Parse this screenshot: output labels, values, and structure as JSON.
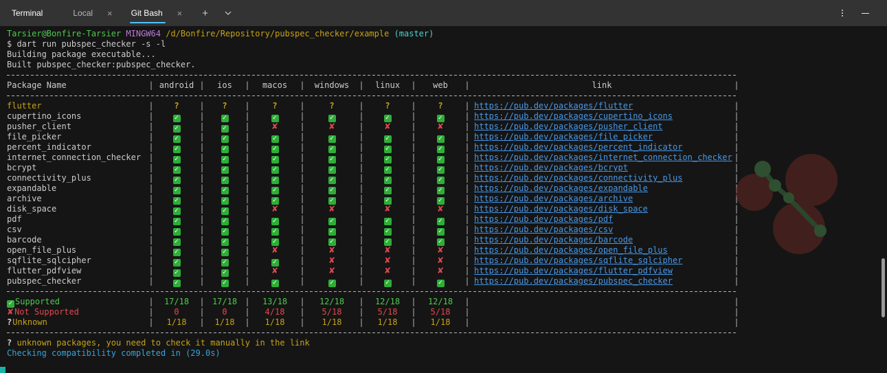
{
  "window": {
    "title": "Terminal",
    "tabs": [
      {
        "label": "Local"
      },
      {
        "label": "Git Bash",
        "active": true
      }
    ],
    "icons": {
      "new_tab": "+",
      "tab_close": "×",
      "dropdown": "chevron-down",
      "menu": "kebab",
      "minimize": "dash"
    }
  },
  "terminal": {
    "prompt": {
      "user_host": "Tarsier@Bonfire-Tarsier",
      "env": "MINGW64",
      "path": "/d/Bonfire/Repository/pubspec_checker/example",
      "branch": "(master)"
    },
    "command": "$ dart run pubspec_checker -s -l",
    "output": [
      "Building package executable...",
      "Built pubspec_checker:pubspec_checker."
    ],
    "table": {
      "headers": [
        "Package Name",
        "android",
        "ios",
        "macos",
        "windows",
        "linux",
        "web",
        "link"
      ],
      "packages": [
        {
          "name": "flutter",
          "highlight": true,
          "marks": [
            "q",
            "q",
            "q",
            "q",
            "q",
            "q"
          ],
          "link": "https://pub.dev/packages/flutter"
        },
        {
          "name": "cupertino_icons",
          "marks": [
            "check",
            "check",
            "check",
            "check",
            "check",
            "check"
          ],
          "link": "https://pub.dev/packages/cupertino_icons"
        },
        {
          "name": "pusher_client",
          "marks": [
            "check",
            "check",
            "cross",
            "cross",
            "cross",
            "cross"
          ],
          "link": "https://pub.dev/packages/pusher_client"
        },
        {
          "name": "file_picker",
          "marks": [
            "check",
            "check",
            "check",
            "check",
            "check",
            "check"
          ],
          "link": "https://pub.dev/packages/file_picker"
        },
        {
          "name": "percent_indicator",
          "marks": [
            "check",
            "check",
            "check",
            "check",
            "check",
            "check"
          ],
          "link": "https://pub.dev/packages/percent_indicator"
        },
        {
          "name": "internet_connection_checker",
          "marks": [
            "check",
            "check",
            "check",
            "check",
            "check",
            "check"
          ],
          "link": "https://pub.dev/packages/internet_connection_checker"
        },
        {
          "name": "bcrypt",
          "marks": [
            "check",
            "check",
            "check",
            "check",
            "check",
            "check"
          ],
          "link": "https://pub.dev/packages/bcrypt"
        },
        {
          "name": "connectivity_plus",
          "marks": [
            "check",
            "check",
            "check",
            "check",
            "check",
            "check"
          ],
          "link": "https://pub.dev/packages/connectivity_plus"
        },
        {
          "name": "expandable",
          "marks": [
            "check",
            "check",
            "check",
            "check",
            "check",
            "check"
          ],
          "link": "https://pub.dev/packages/expandable"
        },
        {
          "name": "archive",
          "marks": [
            "check",
            "check",
            "check",
            "check",
            "check",
            "check"
          ],
          "link": "https://pub.dev/packages/archive"
        },
        {
          "name": "disk_space",
          "marks": [
            "check",
            "check",
            "cross",
            "cross",
            "cross",
            "cross"
          ],
          "link": "https://pub.dev/packages/disk_space"
        },
        {
          "name": "pdf",
          "marks": [
            "check",
            "check",
            "check",
            "check",
            "check",
            "check"
          ],
          "link": "https://pub.dev/packages/pdf"
        },
        {
          "name": "csv",
          "marks": [
            "check",
            "check",
            "check",
            "check",
            "check",
            "check"
          ],
          "link": "https://pub.dev/packages/csv"
        },
        {
          "name": "barcode",
          "marks": [
            "check",
            "check",
            "check",
            "check",
            "check",
            "check"
          ],
          "link": "https://pub.dev/packages/barcode"
        },
        {
          "name": "open_file_plus",
          "marks": [
            "check",
            "check",
            "cross",
            "cross",
            "cross",
            "cross"
          ],
          "link": "https://pub.dev/packages/open_file_plus"
        },
        {
          "name": "sqflite_sqlcipher",
          "marks": [
            "check",
            "check",
            "check",
            "cross",
            "cross",
            "cross"
          ],
          "link": "https://pub.dev/packages/sqflite_sqlcipher"
        },
        {
          "name": "flutter_pdfview",
          "marks": [
            "check",
            "check",
            "cross",
            "cross",
            "cross",
            "cross"
          ],
          "link": "https://pub.dev/packages/flutter_pdfview"
        },
        {
          "name": "pubspec_checker",
          "marks": [
            "check",
            "check",
            "check",
            "check",
            "check",
            "check"
          ],
          "link": "https://pub.dev/packages/pubspec_checker"
        }
      ],
      "summary": [
        {
          "symbol": "check",
          "label": "Supported",
          "color": "green",
          "values": [
            "17/18",
            "17/18",
            "13/18",
            "12/18",
            "12/18",
            "12/18"
          ]
        },
        {
          "symbol": "cross",
          "label": "Not Supported",
          "color": "red",
          "values": [
            "0",
            "0",
            "4/18",
            "5/18",
            "5/18",
            "5/18"
          ]
        },
        {
          "symbol": "question",
          "label": "Unknown",
          "color": "yellow",
          "values": [
            "1/18",
            "1/18",
            "1/18",
            "1/18",
            "1/18",
            "1/18"
          ]
        }
      ]
    },
    "note": {
      "symbol": "?",
      "text": "unknown packages, you need to check it manually in the link"
    },
    "completion": "Checking compatibility completed in (29.0s)"
  },
  "colors": {
    "terminal_bg": "#151515",
    "tabbar_bg": "#333333",
    "accent_blue": "#4cc2ff",
    "text": "#cccccc",
    "dash_gray": "#b4b4b4",
    "green": "#4ecb4e",
    "check_green": "#2eae38",
    "red": "#e2484f",
    "yellow": "#c6a317",
    "magenta": "#bd7ad6",
    "cyan": "#4fd0d0",
    "link_blue": "#4798e8",
    "info_blue": "#38a4da",
    "scrollbar": "#9a9a9a",
    "corner_badge": "#17b3a6"
  }
}
